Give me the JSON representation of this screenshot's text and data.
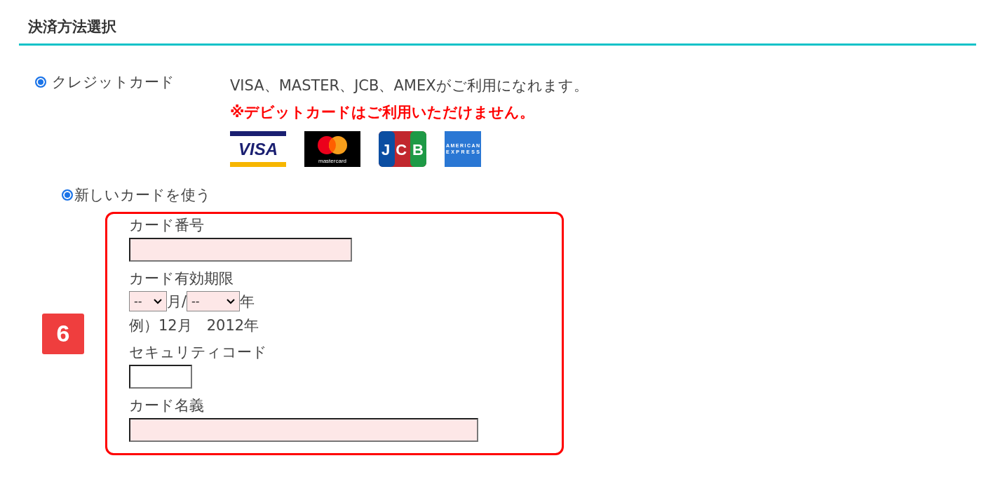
{
  "section": {
    "title": "決済方法選択"
  },
  "payment_option": {
    "label": "クレジットカード",
    "selected": true,
    "note": "VISA、MASTER、JCB、AMEXがご利用になれます。",
    "warning": "※デビットカードはご利用いただけません。"
  },
  "card_logos": [
    {
      "kind": "visa",
      "text": "VISA"
    },
    {
      "kind": "mastercard",
      "text": "mastercard"
    },
    {
      "kind": "jcb",
      "text": "JCB"
    },
    {
      "kind": "amex",
      "lines": [
        "AMERICAN",
        "EXPRESS"
      ]
    }
  ],
  "card_choice": {
    "label": "新しいカードを使う",
    "selected": true
  },
  "step_badge": "6",
  "form": [
    {
      "kind": "text",
      "label": "カード番号",
      "highlighted": true
    },
    {
      "kind": "expiry",
      "label": "カード有効期限",
      "month": {
        "value": "--",
        "highlighted": true
      },
      "month_unit": "月",
      "separator": "/",
      "year": {
        "value": "--",
        "highlighted": true
      },
      "year_unit": "年",
      "example": "例）12月　2012年"
    },
    {
      "kind": "text",
      "label": "セキュリティコード",
      "highlighted": false
    },
    {
      "kind": "text",
      "label": "カード名義",
      "highlighted": true
    }
  ]
}
